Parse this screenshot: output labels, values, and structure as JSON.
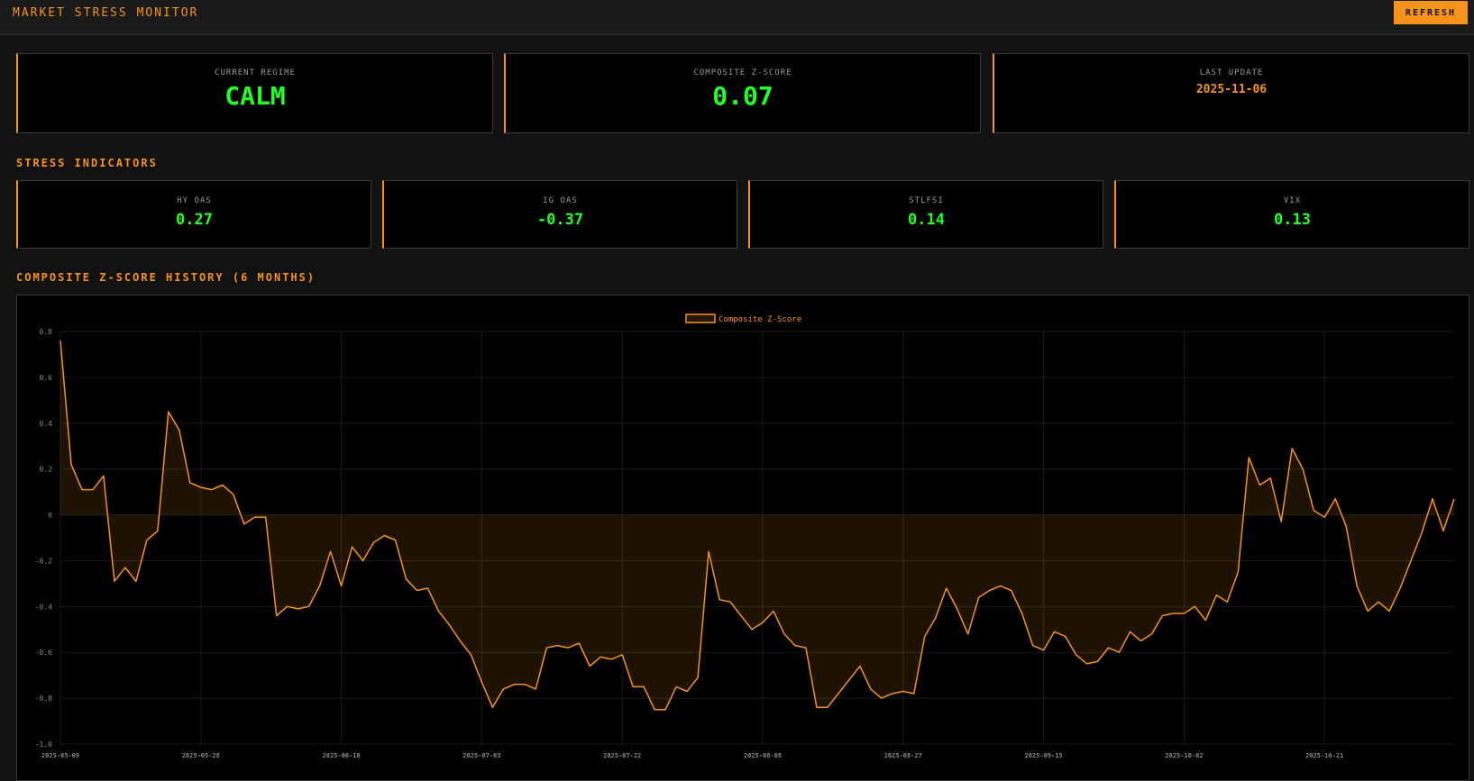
{
  "header": {
    "title": "MARKET STRESS MONITOR",
    "refresh_label": "REFRESH"
  },
  "summary": {
    "regime": {
      "label": "CURRENT REGIME",
      "value": "CALM"
    },
    "composite": {
      "label": "COMPOSITE Z-SCORE",
      "value": "0.07"
    },
    "last_update": {
      "label": "LAST UPDATE",
      "value": "2025-11-06"
    }
  },
  "indicators_title": "STRESS INDICATORS",
  "indicators": [
    {
      "label": "HY OAS",
      "value": "0.27"
    },
    {
      "label": "IG OAS",
      "value": "-0.37"
    },
    {
      "label": "STLFSI",
      "value": "0.14"
    },
    {
      "label": "VIX",
      "value": "0.13"
    }
  ],
  "history_title": "COMPOSITE Z-SCORE HISTORY (6 MONTHS)",
  "colors": {
    "accent": "#f7931a",
    "positive": "#22ff22",
    "background": "#000000"
  },
  "chart_data": {
    "type": "area",
    "legend": "top",
    "grid": true,
    "ylim": [
      -1.0,
      0.8
    ],
    "yticks": [
      0.8,
      0.6,
      0.4,
      0.2,
      0,
      -0.2,
      -0.4,
      -0.6,
      -0.8,
      -1.0
    ],
    "ytick_labels": [
      "0.8",
      "0.6",
      "0.4",
      "0.2",
      "0",
      "-0.2",
      "-0.4",
      "-0.6",
      "-0.8",
      "-1.0"
    ],
    "xrange": [
      0,
      129
    ],
    "xticks": [
      0,
      13,
      26,
      39,
      52,
      65,
      78,
      91,
      104,
      117
    ],
    "xtick_labels": [
      "2025-05-09",
      "2025-05-28",
      "2025-06-16",
      "2025-07-03",
      "2025-07-22",
      "2025-08-08",
      "2025-08-27",
      "2025-09-15",
      "2025-10-02",
      "2025-10-21"
    ],
    "series": [
      {
        "name": "Composite Z-Score",
        "color": "#f7931a",
        "values": [
          0.76,
          0.22,
          0.11,
          0.11,
          0.17,
          -0.29,
          -0.23,
          -0.29,
          -0.11,
          -0.07,
          0.45,
          0.37,
          0.14,
          0.12,
          0.11,
          0.13,
          0.09,
          -0.04,
          -0.01,
          -0.01,
          -0.44,
          -0.4,
          -0.41,
          -0.4,
          -0.31,
          -0.16,
          -0.31,
          -0.14,
          -0.2,
          -0.12,
          -0.09,
          -0.11,
          -0.28,
          -0.33,
          -0.32,
          -0.42,
          -0.48,
          -0.55,
          -0.61,
          -0.73,
          -0.84,
          -0.76,
          -0.74,
          -0.74,
          -0.76,
          -0.58,
          -0.57,
          -0.58,
          -0.56,
          -0.66,
          -0.62,
          -0.63,
          -0.61,
          -0.75,
          -0.75,
          -0.85,
          -0.85,
          -0.75,
          -0.77,
          -0.71,
          -0.16,
          -0.37,
          -0.38,
          -0.44,
          -0.5,
          -0.47,
          -0.42,
          -0.52,
          -0.57,
          -0.58,
          -0.84,
          -0.84,
          -0.78,
          -0.72,
          -0.66,
          -0.76,
          -0.8,
          -0.78,
          -0.77,
          -0.78,
          -0.53,
          -0.45,
          -0.32,
          -0.41,
          -0.52,
          -0.36,
          -0.33,
          -0.31,
          -0.33,
          -0.43,
          -0.57,
          -0.59,
          -0.51,
          -0.53,
          -0.61,
          -0.65,
          -0.64,
          -0.58,
          -0.6,
          -0.51,
          -0.55,
          -0.52,
          -0.44,
          -0.43,
          -0.43,
          -0.4,
          -0.46,
          -0.35,
          -0.38,
          -0.25,
          0.25,
          0.13,
          0.16,
          -0.03,
          0.29,
          0.2,
          0.02,
          -0.01,
          0.07,
          -0.05,
          -0.31,
          -0.42,
          -0.38,
          -0.42,
          -0.32,
          -0.2,
          -0.08,
          0.07,
          -0.07,
          0.07
        ]
      }
    ]
  }
}
